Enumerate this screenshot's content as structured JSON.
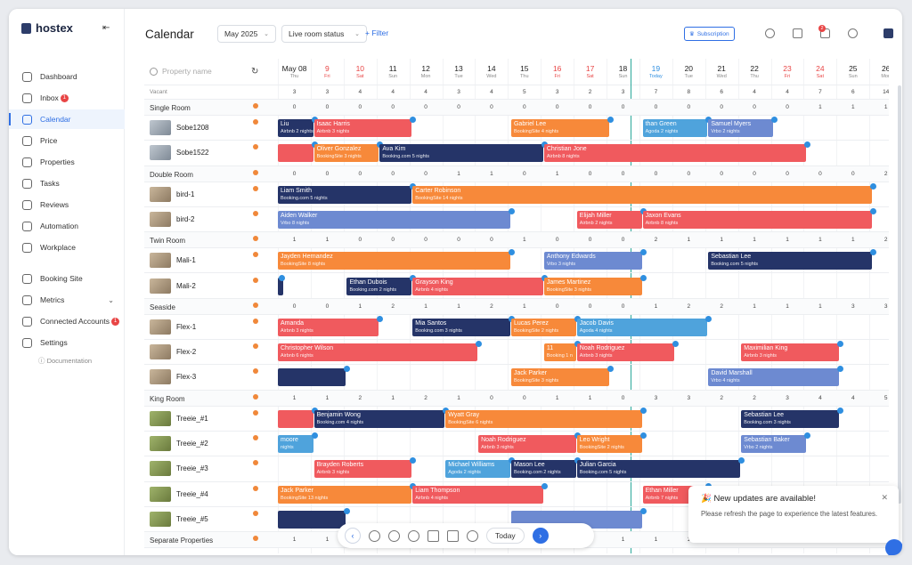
{
  "app": {
    "name": "hostex"
  },
  "sidebar": {
    "items": [
      {
        "label": "Dashboard",
        "icon": "dashboard-icon"
      },
      {
        "label": "Inbox",
        "icon": "inbox-icon",
        "badge": "1"
      },
      {
        "label": "Calendar",
        "icon": "calendar-icon",
        "active": true
      },
      {
        "label": "Price",
        "icon": "price-icon"
      },
      {
        "label": "Properties",
        "icon": "home-icon"
      },
      {
        "label": "Tasks",
        "icon": "tasks-icon"
      },
      {
        "label": "Reviews",
        "icon": "star-icon"
      },
      {
        "label": "Automation",
        "icon": "automation-icon"
      },
      {
        "label": "Workplace",
        "icon": "workplace-icon"
      },
      {
        "label": "Booking Site",
        "icon": "booking-site-icon"
      },
      {
        "label": "Metrics",
        "icon": "metrics-icon"
      },
      {
        "label": "Connected Accounts",
        "icon": "connected-accounts-icon",
        "badge": "1"
      },
      {
        "label": "Settings",
        "icon": "settings-icon"
      }
    ],
    "documentation": "Documentation"
  },
  "header": {
    "title": "Calendar",
    "month": "May 2025",
    "status_filter": "Live room status",
    "add_filter": "+ Filter",
    "subscription": "Subscription",
    "notif_badge": "2"
  },
  "calendar": {
    "search_placeholder": "Property name",
    "vacant_label": "Vacant",
    "days": [
      {
        "d": "May 08",
        "w": "Thu"
      },
      {
        "d": "9",
        "w": "Fri",
        "we": true
      },
      {
        "d": "10",
        "w": "Sat",
        "we": true
      },
      {
        "d": "11",
        "w": "Sun"
      },
      {
        "d": "12",
        "w": "Mon"
      },
      {
        "d": "13",
        "w": "Tue"
      },
      {
        "d": "14",
        "w": "Wed"
      },
      {
        "d": "15",
        "w": "Thu"
      },
      {
        "d": "16",
        "w": "Fri",
        "we": true
      },
      {
        "d": "17",
        "w": "Sat",
        "we": true
      },
      {
        "d": "18",
        "w": "Sun"
      },
      {
        "d": "19",
        "w": "Today",
        "today": true
      },
      {
        "d": "20",
        "w": "Tue"
      },
      {
        "d": "21",
        "w": "Wed"
      },
      {
        "d": "22",
        "w": "Thu"
      },
      {
        "d": "23",
        "w": "Fri",
        "we": true
      },
      {
        "d": "24",
        "w": "Sat",
        "we": true
      },
      {
        "d": "25",
        "w": "Sun"
      },
      {
        "d": "26",
        "w": "Mon"
      }
    ],
    "vacant": [
      "3",
      "3",
      "4",
      "4",
      "4",
      "3",
      "4",
      "5",
      "3",
      "2",
      "3",
      "7",
      "8",
      "6",
      "4",
      "4",
      "7",
      "6",
      "14"
    ],
    "rows": [
      {
        "type": "group",
        "name": "Single Room",
        "counts": [
          "0",
          "0",
          "0",
          "0",
          "0",
          "0",
          "0",
          "0",
          "0",
          "0",
          "0",
          "0",
          "0",
          "0",
          "0",
          "0",
          "1",
          "1",
          "1"
        ]
      },
      {
        "type": "prop",
        "name": "Sobe1208",
        "th": "b"
      },
      {
        "type": "prop",
        "name": "Sobe1522",
        "th": "b"
      },
      {
        "type": "group",
        "name": "Double Room",
        "counts": [
          "0",
          "0",
          "0",
          "0",
          "0",
          "1",
          "1",
          "0",
          "1",
          "0",
          "0",
          "0",
          "0",
          "0",
          "0",
          "0",
          "0",
          "0",
          "2"
        ]
      },
      {
        "type": "prop",
        "name": "bird-1",
        "th": "t"
      },
      {
        "type": "prop",
        "name": "bird-2",
        "th": "t"
      },
      {
        "type": "group",
        "name": "Twin Room",
        "counts": [
          "1",
          "1",
          "0",
          "0",
          "0",
          "0",
          "0",
          "1",
          "0",
          "0",
          "0",
          "2",
          "1",
          "1",
          "1",
          "1",
          "1",
          "1",
          "2"
        ]
      },
      {
        "type": "prop",
        "name": "Mali-1",
        "th": "t"
      },
      {
        "type": "prop",
        "name": "Mali-2",
        "th": "t"
      },
      {
        "type": "group",
        "name": "Seaside",
        "counts": [
          "0",
          "0",
          "1",
          "2",
          "1",
          "1",
          "2",
          "1",
          "0",
          "0",
          "0",
          "1",
          "2",
          "2",
          "1",
          "1",
          "1",
          "3",
          "3"
        ]
      },
      {
        "type": "prop",
        "name": "Flex-1",
        "th": "t"
      },
      {
        "type": "prop",
        "name": "Flex-2",
        "th": "t"
      },
      {
        "type": "prop",
        "name": "Flex-3",
        "th": "t"
      },
      {
        "type": "group",
        "name": "King Room",
        "counts": [
          "1",
          "1",
          "2",
          "1",
          "2",
          "1",
          "0",
          "0",
          "1",
          "1",
          "0",
          "3",
          "3",
          "2",
          "2",
          "3",
          "4",
          "4",
          "5"
        ]
      },
      {
        "type": "prop",
        "name": "Treeie_#1",
        "th": "g"
      },
      {
        "type": "prop",
        "name": "Treeie_#2",
        "th": "g"
      },
      {
        "type": "prop",
        "name": "Treeie_#3",
        "th": "g"
      },
      {
        "type": "prop",
        "name": "Treeie_#4",
        "th": "g"
      },
      {
        "type": "prop",
        "name": "Treeie_#5",
        "th": "g"
      },
      {
        "type": "group",
        "name": "Separate Properties",
        "counts": [
          "1",
          "1",
          "1",
          "1",
          "1",
          "1",
          "1",
          "1",
          "1",
          "1",
          "1",
          "1",
          "1",
          "1",
          "1",
          "1",
          "1",
          "1",
          "1"
        ]
      }
    ],
    "bookings": [
      {
        "row": 1,
        "s": -0.3,
        "e": 1.1,
        "name": "Liu",
        "sub": "Airbnb 2 nights",
        "c": "n"
      },
      {
        "row": 1,
        "s": 1.1,
        "e": 4.1,
        "name": "Isaac Harris",
        "sub": "Airbnb 3 nights",
        "c": "r"
      },
      {
        "row": 1,
        "s": 7.1,
        "e": 10.1,
        "name": "Gabriel Lee",
        "sub": "BookingSite 4 nights",
        "c": "o"
      },
      {
        "row": 1,
        "s": 11.1,
        "e": 13.1,
        "name": "than Green",
        "sub": "Agoda 2 nights",
        "c": "b"
      },
      {
        "row": 1,
        "s": 13.1,
        "e": 15.1,
        "name": "Samuel Myers",
        "sub": "Vrbo 2 nights",
        "c": "p"
      },
      {
        "row": 2,
        "s": -0.3,
        "e": 1.1,
        "name": "",
        "sub": "",
        "c": "r"
      },
      {
        "row": 2,
        "s": 1.1,
        "e": 3.1,
        "name": "Oliver Gonzalez",
        "sub": "BookingSite 3 nights",
        "c": "o"
      },
      {
        "row": 2,
        "s": 3.1,
        "e": 8.1,
        "name": "Ava Kim",
        "sub": "Booking.com 5 nights",
        "c": "n"
      },
      {
        "row": 2,
        "s": 8.1,
        "e": 16.1,
        "name": "Christian Jone",
        "sub": "Airbnb 8 nights",
        "c": "r"
      },
      {
        "row": 4,
        "s": -0.3,
        "e": 4.1,
        "name": "Liam Smith",
        "sub": "Booking.com 5 nights",
        "c": "n"
      },
      {
        "row": 4,
        "s": 4.1,
        "e": 18.1,
        "name": "Carter Robinson",
        "sub": "BookingSite 14 nights",
        "c": "o"
      },
      {
        "row": 5,
        "s": -0.3,
        "e": 7.1,
        "name": "Aiden Walker",
        "sub": "Vrbo 8 nights",
        "c": "p"
      },
      {
        "row": 5,
        "s": 9.1,
        "e": 11.1,
        "name": "Elijah Miller",
        "sub": "Airbnb 2 nights",
        "c": "r"
      },
      {
        "row": 5,
        "s": 11.1,
        "e": 18.1,
        "name": "Jaxon Evans",
        "sub": "Airbnb 8 nights",
        "c": "r"
      },
      {
        "row": 7,
        "s": -0.3,
        "e": 7.1,
        "name": "Jayden Hernandez",
        "sub": "BookingSite 8 nights",
        "c": "o"
      },
      {
        "row": 7,
        "s": 8.1,
        "e": 11.1,
        "name": "Anthony Edwards",
        "sub": "Vrbo 3 nights",
        "c": "p"
      },
      {
        "row": 7,
        "s": 13.1,
        "e": 18.1,
        "name": "Sebastian Lee",
        "sub": "Booking.com 5 nights",
        "c": "n"
      },
      {
        "row": 8,
        "s": -0.3,
        "e": 0.1,
        "name": "",
        "sub": "",
        "c": "n"
      },
      {
        "row": 8,
        "s": 2.1,
        "e": 4.1,
        "name": "Ethan Dubois",
        "sub": "Booking.com 2 nights",
        "c": "n"
      },
      {
        "row": 8,
        "s": 4.1,
        "e": 8.1,
        "name": "Grayson King",
        "sub": "Airbnb 4 nights",
        "c": "r"
      },
      {
        "row": 8,
        "s": 8.1,
        "e": 11.1,
        "name": "James Martinez",
        "sub": "BookingSite 3 nights",
        "c": "o"
      },
      {
        "row": 10,
        "s": -0.3,
        "e": 3.1,
        "name": "Amanda",
        "sub": "Airbnb 3 nights",
        "c": "r"
      },
      {
        "row": 10,
        "s": 4.1,
        "e": 7.1,
        "name": "Mia Santos",
        "sub": "Booking.com 3 nights",
        "c": "n"
      },
      {
        "row": 10,
        "s": 7.1,
        "e": 9.1,
        "name": "Lucas Perez",
        "sub": "BookingSite 2 nights",
        "c": "o"
      },
      {
        "row": 10,
        "s": 9.1,
        "e": 13.1,
        "name": "Jacob Davis",
        "sub": "Agoda 4 nights",
        "c": "b"
      },
      {
        "row": 11,
        "s": -0.3,
        "e": 6.1,
        "name": "Christopher Wilson",
        "sub": "Airbnb 6 nights",
        "c": "r"
      },
      {
        "row": 11,
        "s": 8.1,
        "e": 9.1,
        "name": "11",
        "sub": "Booking 1 n",
        "c": "o"
      },
      {
        "row": 11,
        "s": 9.1,
        "e": 12.1,
        "name": "Noah Rodriguez",
        "sub": "Airbnb 3 nights",
        "c": "r"
      },
      {
        "row": 11,
        "s": 14.1,
        "e": 17.1,
        "name": "Maximilian King",
        "sub": "Airbnb 3 nights",
        "c": "r"
      },
      {
        "row": 12,
        "s": -0.3,
        "e": 2.1,
        "name": "",
        "sub": "",
        "c": "n"
      },
      {
        "row": 12,
        "s": 7.1,
        "e": 10.1,
        "name": "Jack Parker",
        "sub": "BookingSite 3 nights",
        "c": "o"
      },
      {
        "row": 12,
        "s": 13.1,
        "e": 17.1,
        "name": "David Marshall",
        "sub": "Vrbo 4 nights",
        "c": "p"
      },
      {
        "row": 14,
        "s": -0.3,
        "e": 1.1,
        "name": "",
        "sub": "",
        "c": "r"
      },
      {
        "row": 14,
        "s": 1.1,
        "e": 5.1,
        "name": "Benjamin Wong",
        "sub": "Booking.com 4 nights",
        "c": "n"
      },
      {
        "row": 14,
        "s": 5.1,
        "e": 11.1,
        "name": "Wyatt Gray",
        "sub": "BookingSite 6 nights",
        "c": "o"
      },
      {
        "row": 14,
        "s": 14.1,
        "e": 17.1,
        "name": "Sebastian Lee",
        "sub": "Booking.com 3 nights",
        "c": "n"
      },
      {
        "row": 15,
        "s": -0.3,
        "e": 1.1,
        "name": "moore",
        "sub": "nights",
        "c": "b"
      },
      {
        "row": 15,
        "s": 6.1,
        "e": 9.1,
        "name": "Noah Rodriguez",
        "sub": "Airbnb 3 nights",
        "c": "r"
      },
      {
        "row": 15,
        "s": 9.1,
        "e": 11.1,
        "name": "Leo Wright",
        "sub": "BookingSite 2 nights",
        "c": "o"
      },
      {
        "row": 15,
        "s": 14.1,
        "e": 16.1,
        "name": "Sebastian Baker",
        "sub": "Vrbo 2 nights",
        "c": "p"
      },
      {
        "row": 16,
        "s": 1.1,
        "e": 4.1,
        "name": "Brayden Roberts",
        "sub": "Airbnb 3 nights",
        "c": "r"
      },
      {
        "row": 16,
        "s": 5.1,
        "e": 7.1,
        "name": "Michael Williams",
        "sub": "Agoda 2 nights",
        "c": "b"
      },
      {
        "row": 16,
        "s": 7.1,
        "e": 9.1,
        "name": "Mason Lee",
        "sub": "Booking.com 2 nights",
        "c": "n"
      },
      {
        "row": 16,
        "s": 9.1,
        "e": 14.1,
        "name": "Julian Garcia",
        "sub": "Booking.com 5 nights",
        "c": "n"
      },
      {
        "row": 17,
        "s": -0.3,
        "e": 4.1,
        "name": "Jack Parker",
        "sub": "BookingSite 13 nights",
        "c": "o"
      },
      {
        "row": 17,
        "s": 4.1,
        "e": 8.1,
        "name": "Liam Thompson",
        "sub": "Airbnb 4 nights",
        "c": "r"
      },
      {
        "row": 17,
        "s": 11.1,
        "e": 13.1,
        "name": "Ethan Miller",
        "sub": "Airbnb 7 nights",
        "c": "r"
      },
      {
        "row": 18,
        "s": -0.3,
        "e": 2.1,
        "name": "",
        "sub": "",
        "c": "n"
      },
      {
        "row": 18,
        "s": 7.1,
        "e": 11.1,
        "name": "",
        "sub": "",
        "c": "p"
      }
    ]
  },
  "toolbar": {
    "today": "Today"
  },
  "toast": {
    "title": "🎉 New updates are available!",
    "body": "Please refresh the page to experience the latest features."
  }
}
